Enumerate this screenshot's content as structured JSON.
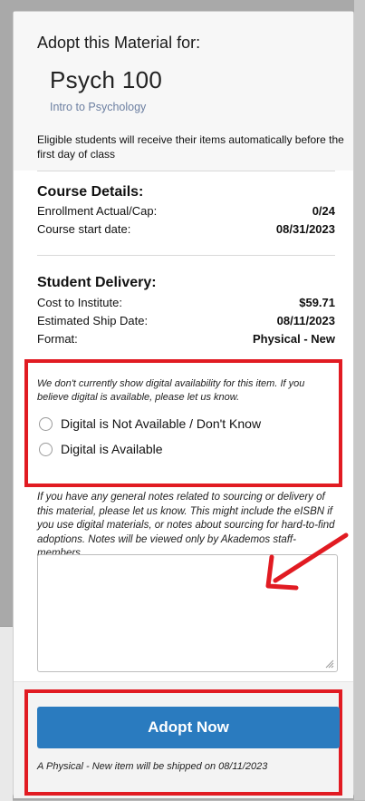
{
  "header": {
    "adopt_for_label": "Adopt this Material for:",
    "course_code": "Psych 100",
    "course_name": "Intro to Psychology",
    "eligible_note": "Eligible students will receive their items automatically before the first day of class"
  },
  "course_details": {
    "title": "Course Details:",
    "rows": [
      {
        "label": "Enrollment Actual/Cap:",
        "value": "0/24"
      },
      {
        "label": "Course start date:",
        "value": "08/31/2023"
      }
    ]
  },
  "student_delivery": {
    "title": "Student Delivery:",
    "rows": [
      {
        "label": "Cost to Institute:",
        "value": "$59.71"
      },
      {
        "label": "Estimated Ship Date:",
        "value": "08/11/2023"
      },
      {
        "label": "Format:",
        "value": "Physical - New"
      }
    ]
  },
  "digital": {
    "note": "We don't currently show digital availability for this item. If you believe digital is available, please let us know.",
    "options": [
      {
        "label": "Digital is Not Available / Don't Know",
        "selected": false
      },
      {
        "label": "Digital is Available",
        "selected": false
      }
    ]
  },
  "notes": {
    "help_text": "If you have any general notes related to sourcing or delivery of this material, please let us know. This might include the eISBN if you use digital materials, or notes about sourcing for hard-to-find adoptions. Notes will be viewed only by Akademos staff-members.",
    "value": "",
    "placeholder": ""
  },
  "action": {
    "button_label": "Adopt Now",
    "ship_note": "A Physical - New item will be shipped on 08/11/2023"
  },
  "colors": {
    "highlight_red": "#e11b22",
    "button_blue": "#2a7bbf",
    "link_gray_blue": "#6c7fa1"
  },
  "icons": [
    "resize-handle-icon",
    "arrow-annotation-icon"
  ]
}
